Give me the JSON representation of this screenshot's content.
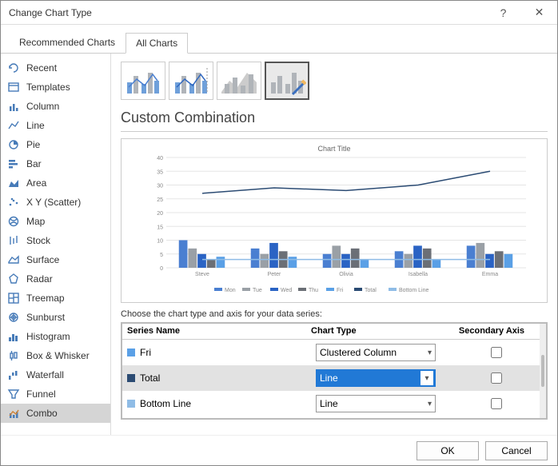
{
  "titlebar": {
    "title": "Change Chart Type",
    "help": "?",
    "close": "✕"
  },
  "tabs": {
    "recommended": "Recommended Charts",
    "all": "All Charts"
  },
  "sidebar": {
    "items": [
      {
        "label": "Recent",
        "icon": "recent"
      },
      {
        "label": "Templates",
        "icon": "templates"
      },
      {
        "label": "Column",
        "icon": "column"
      },
      {
        "label": "Line",
        "icon": "line"
      },
      {
        "label": "Pie",
        "icon": "pie"
      },
      {
        "label": "Bar",
        "icon": "bar"
      },
      {
        "label": "Area",
        "icon": "area"
      },
      {
        "label": "X Y (Scatter)",
        "icon": "scatter"
      },
      {
        "label": "Map",
        "icon": "map"
      },
      {
        "label": "Stock",
        "icon": "stock"
      },
      {
        "label": "Surface",
        "icon": "surface"
      },
      {
        "label": "Radar",
        "icon": "radar"
      },
      {
        "label": "Treemap",
        "icon": "treemap"
      },
      {
        "label": "Sunburst",
        "icon": "sunburst"
      },
      {
        "label": "Histogram",
        "icon": "histogram"
      },
      {
        "label": "Box & Whisker",
        "icon": "box"
      },
      {
        "label": "Waterfall",
        "icon": "waterfall"
      },
      {
        "label": "Funnel",
        "icon": "funnel"
      },
      {
        "label": "Combo",
        "icon": "combo"
      }
    ],
    "selected_index": 18
  },
  "subtypes": {
    "selected_index": 3
  },
  "section_title": "Custom Combination",
  "preview_title": "Chart Title",
  "chart_data": {
    "type": "combo",
    "title": "Chart Title",
    "ylim": [
      0,
      40
    ],
    "yticks": [
      0,
      5,
      10,
      15,
      20,
      25,
      30,
      35,
      40
    ],
    "categories": [
      "Steve",
      "Peter",
      "Olivia",
      "Isabella",
      "Emma"
    ],
    "legend": [
      "Mon",
      "Tue",
      "Wed",
      "Thu",
      "Fri",
      "Total",
      "Bottom Line"
    ],
    "legend_colors": {
      "Mon": "#4a7fd1",
      "Tue": "#9aa0a6",
      "Wed": "#2a63c4",
      "Thu": "#6b6f76",
      "Fri": "#5aa0e6",
      "Total": "#2b4b73",
      "Bottom Line": "#8fbce6"
    },
    "bar_series": [
      {
        "name": "Mon",
        "color": "#4a7fd1",
        "values": [
          10,
          7,
          5,
          6,
          8
        ]
      },
      {
        "name": "Tue",
        "color": "#9aa0a6",
        "values": [
          7,
          5,
          8,
          5,
          9
        ]
      },
      {
        "name": "Wed",
        "color": "#2a63c4",
        "values": [
          5,
          9,
          5,
          8,
          5
        ]
      },
      {
        "name": "Thu",
        "color": "#6b6f76",
        "values": [
          3,
          6,
          7,
          7,
          6
        ]
      },
      {
        "name": "Fri",
        "color": "#5aa0e6",
        "values": [
          4,
          4,
          3,
          3,
          5
        ]
      }
    ],
    "line_series": [
      {
        "name": "Total",
        "color": "#2b4b73",
        "values": [
          27,
          29,
          28,
          30,
          35
        ]
      },
      {
        "name": "Bottom Line",
        "color": "#8fbce6",
        "values": [
          3,
          3,
          3,
          3,
          3
        ]
      }
    ]
  },
  "series_section_label": "Choose the chart type and axis for your data series:",
  "series_table": {
    "headers": {
      "name": "Series Name",
      "type": "Chart Type",
      "sec": "Secondary Axis"
    },
    "rows": [
      {
        "name": "Fri",
        "swatch": "#5aa0e6",
        "type": "Clustered Column",
        "secondary": false,
        "selected": false
      },
      {
        "name": "Total",
        "swatch": "#2b4b73",
        "type": "Line",
        "secondary": false,
        "selected": true
      },
      {
        "name": "Bottom Line",
        "swatch": "#8fbce6",
        "type": "Line",
        "secondary": false,
        "selected": false
      }
    ]
  },
  "footer": {
    "ok": "OK",
    "cancel": "Cancel"
  }
}
